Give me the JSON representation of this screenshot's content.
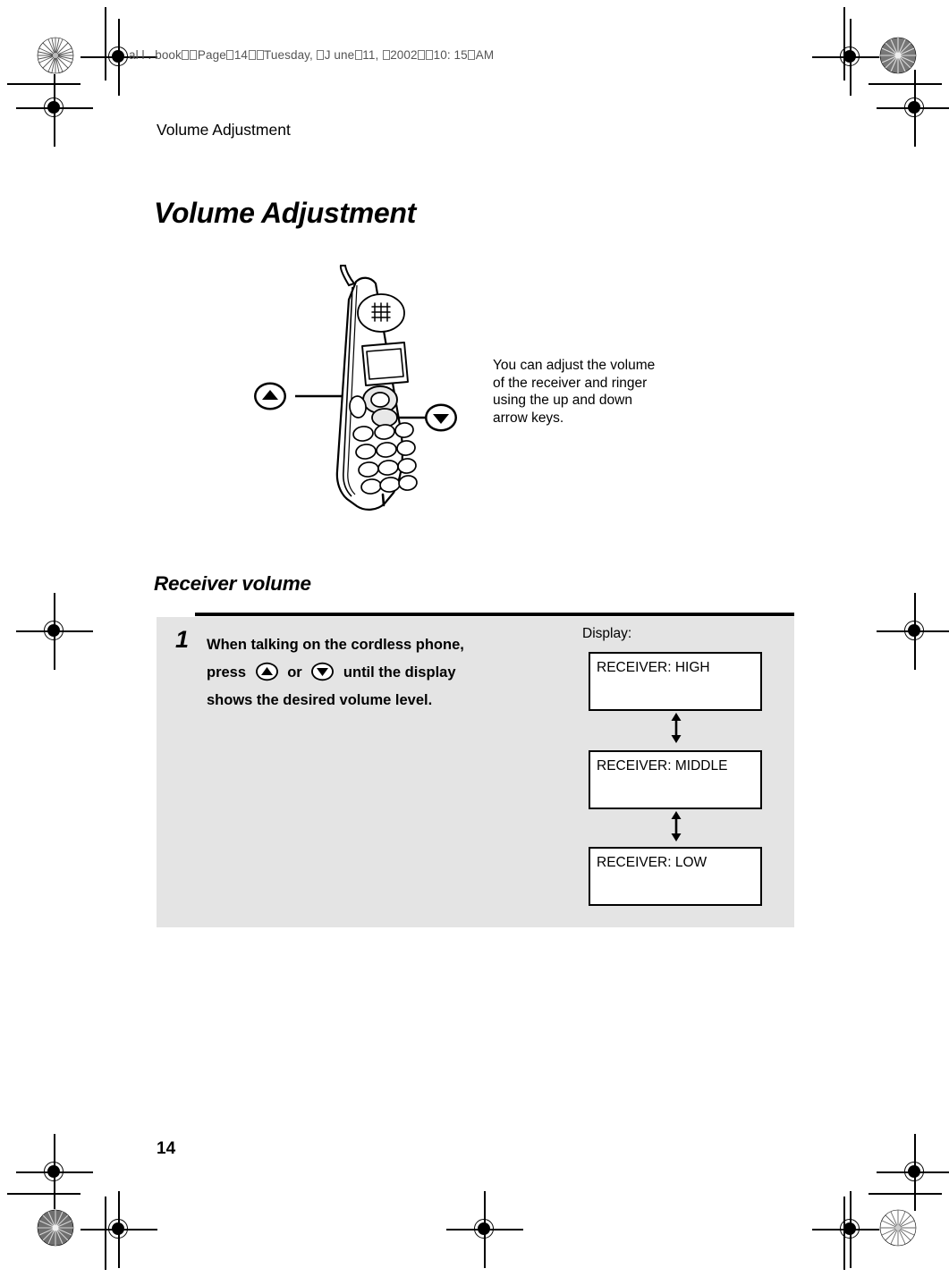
{
  "file_header": {
    "parts": [
      "al l . book",
      "Page",
      "14",
      "Tuesday, ",
      "J une",
      "11, ",
      "2002",
      "10: 15",
      "AM"
    ],
    "full_text": "al l . book  Page 14  Tuesday, J une 11, 2002  10: 15 AM"
  },
  "running_head": "Volume Adjustment",
  "chapter_title": "Volume Adjustment",
  "illustration": {
    "device": "cordless-phone-handset",
    "up_callout_icon": "up-arrow-key-icon",
    "down_callout_icon": "down-arrow-key-icon",
    "note": "You can adjust the volume\nof the receiver and ringer\nusing the up and down\narrow keys."
  },
  "section_title": "Receiver volume",
  "step": {
    "number": "1",
    "line1": "When talking on the cordless phone,",
    "line2_pre": "press",
    "line2_mid": "or",
    "line2_post": "until the display",
    "line3": "shows the desired volume level.",
    "up_key_icon": "up-arrow-key-icon",
    "down_key_icon": "down-arrow-key-icon"
  },
  "display": {
    "label": "Display:",
    "boxes": [
      {
        "text": "RECEIVER: HIGH"
      },
      {
        "text": "RECEIVER: MIDDLE"
      },
      {
        "text": "RECEIVER: LOW"
      }
    ],
    "separator_icon": "double-headed-vertical-arrow-icon"
  },
  "page_number": "14",
  "colors": {
    "panel_background": "#e4e4e4",
    "ink": "#000000",
    "page_background": "#ffffff",
    "header_gray": "#555555"
  }
}
